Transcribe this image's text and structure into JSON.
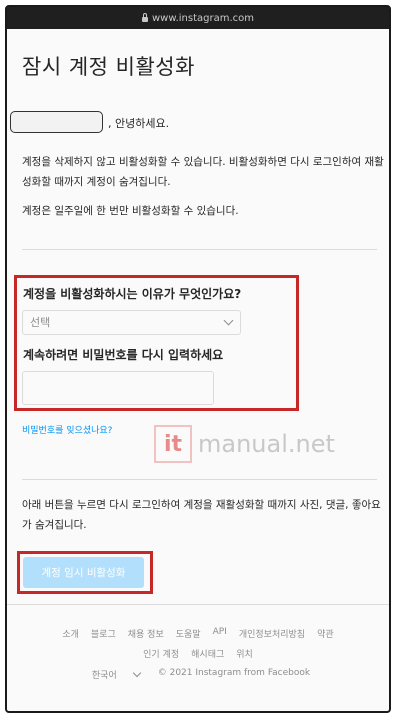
{
  "browser": {
    "url": "www.instagram.com"
  },
  "page": {
    "title": "잠시 계정 비활성화",
    "greeting": ", 안녕하세요.",
    "paragraph1": "계정을 삭제하지 않고 비활성화할 수 있습니다. 비활성화하면 다시 로그인하여 재활성화할 때까지 계정이 숨겨집니다.",
    "paragraph2": "계정은 일주일에 한 번만 비활성화할 수 있습니다.",
    "reason_question": "계정을 비활성화하시는 이유가 무엇인가요?",
    "reason_select_value": "선택",
    "password_prompt": "계속하려면 비밀번호를 다시 입력하세요",
    "password_value": "",
    "forgot_password_link": "비밀번호를 잊으셨나요?",
    "paragraph3": "아래 버튼을 누르면 다시 로그인하여 계정을 재활성화할 때까지 사진, 댓글, 좋아요가 숨겨집니다.",
    "deactivate_button": "계정 임시 비활성화"
  },
  "watermark": {
    "logo": "it",
    "text": "manual.net"
  },
  "footer": {
    "links_row1": [
      "소개",
      "블로그",
      "채용 정보",
      "도움말",
      "API",
      "개인정보처리방침",
      "약관"
    ],
    "links_row2": [
      "인기 계정",
      "해시태그",
      "위치"
    ],
    "language": "한국어",
    "copyright": "© 2021 Instagram from Facebook"
  },
  "colors": {
    "link": "#0095f6",
    "button_disabled": "#b2dffc",
    "highlight": "#c62828"
  }
}
